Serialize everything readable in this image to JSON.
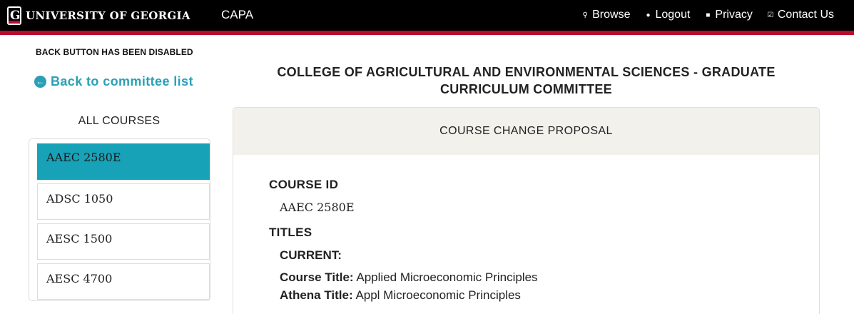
{
  "header": {
    "logo_text": "UNIVERSITY OF GEORGIA",
    "app_name": "CAPA",
    "nav": [
      {
        "label": "Browse",
        "icon": "search-icon"
      },
      {
        "label": "Logout",
        "icon": "logout-icon"
      },
      {
        "label": "Privacy",
        "icon": "privacy-icon"
      },
      {
        "label": "Contact Us",
        "icon": "contact-icon"
      }
    ],
    "colors": {
      "bar": "#000000",
      "stripe": "#ba0c2f"
    }
  },
  "sidebar": {
    "notice": "BACK BUTTON HAS BEEN DISABLED",
    "back_link": "Back to committee list",
    "list_heading": "ALL COURSES",
    "courses": [
      {
        "label": "AAEC 2580E",
        "active": true
      },
      {
        "label": "ADSC 1050",
        "active": false
      },
      {
        "label": "AESC 1500",
        "active": false
      },
      {
        "label": "AESC 4700",
        "active": false
      }
    ],
    "accent_color": "#17a2b8"
  },
  "main": {
    "committee_title_line1": "COLLEGE OF AGRICULTURAL AND ENVIRONMENTAL SCIENCES - GRADUATE",
    "committee_title_line2": "CURRICULUM COMMITTEE",
    "card_header": "COURSE CHANGE PROPOSAL",
    "course_id_label": "COURSE ID",
    "course_id_value": "AAEC 2580E",
    "titles_label": "TITLES",
    "current_label": "CURRENT:",
    "course_title_label": "Course Title:",
    "course_title_value": "Applied Microeconomic Principles",
    "athena_title_label": "Athena Title:",
    "athena_title_value": "Appl Microeconomic Principles"
  }
}
